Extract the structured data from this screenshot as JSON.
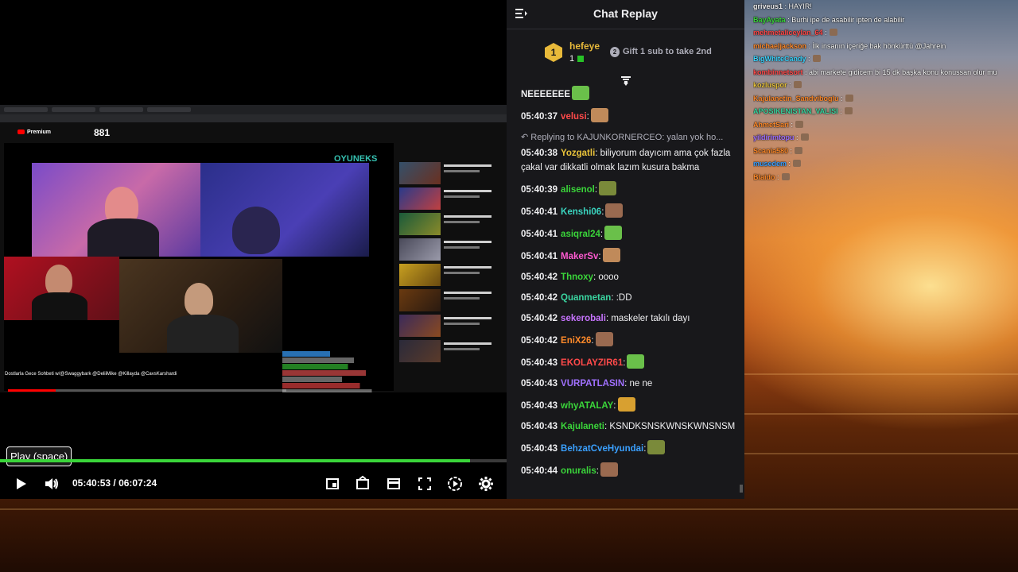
{
  "player": {
    "tooltip": "Play (space)",
    "current_time": "05:40:53",
    "separator": "/",
    "duration": "06:07:24",
    "progress_fraction": 0.928,
    "accent_color": "#3ad53a",
    "controls": {
      "play_icon": "play-icon",
      "volume_icon": "volume-icon",
      "miniplayer_icon": "miniplayer-icon",
      "theater_icon": "theater-icon",
      "cinema_icon": "cinema-icon",
      "fullscreen_icon": "fullscreen-icon",
      "speed_icon": "speed-icon",
      "settings_icon": "gear-icon"
    }
  },
  "video": {
    "viewer_count": "881",
    "site_label": "Premium",
    "overlay_logo": "OYUNEKS",
    "stream_title": "Dostlarla Gece Sohbeti w/@Swaggybark @DeliiMike @Killayda @CavsKarshardi"
  },
  "chat": {
    "title": "Chat Replay",
    "leaderboard": {
      "rank1": "1",
      "rank1_name": "hefeye",
      "rank1_count": "1",
      "rank2": "2",
      "rank2_text": "Gift 1 sub to take 2nd"
    },
    "messages": [
      {
        "ts": "",
        "user": "",
        "user_color": "#efeff1",
        "text": "NEEEEEEE"
      },
      {
        "ts": "05:40:37",
        "user": "velusi",
        "user_color": "#ff4a4a",
        "text": ":"
      },
      {
        "reply": "Replying to KAJUNKORNERCEO: yalan yok ho..."
      },
      {
        "ts": "05:40:38",
        "user": "Yozgatli",
        "user_color": "#e8c23a",
        "text": ": biliyorum dayıcım ama çok fazla çakal var dikkatli olmak lazım kusura bakma"
      },
      {
        "ts": "05:40:39",
        "user": "alisenol",
        "user_color": "#3ad53a",
        "text": ":"
      },
      {
        "ts": "05:40:41",
        "user": "Kenshi06",
        "user_color": "#3ad5c0",
        "text": ":"
      },
      {
        "ts": "05:40:41",
        "user": "asiqral24",
        "user_color": "#3ad53a",
        "text": ":"
      },
      {
        "ts": "05:40:41",
        "user": "MakerSv",
        "user_color": "#ff5ad1",
        "text": ":"
      },
      {
        "ts": "05:40:42",
        "user": "Thnoxy",
        "user_color": "#3ad53a",
        "text": ": oooo"
      },
      {
        "ts": "05:40:42",
        "user": "Quanmetan",
        "user_color": "#3ad5a0",
        "text": ": :DD"
      },
      {
        "ts": "05:40:42",
        "user": "sekerobali",
        "user_color": "#c774ff",
        "text": ": maskeler takılı dayı"
      },
      {
        "ts": "05:40:42",
        "user": "EniX26",
        "user_color": "#ff8a2a",
        "text": ":"
      },
      {
        "ts": "05:40:43",
        "user": "EKOLAYZIR61",
        "user_color": "#ff4a4a",
        "text": ":"
      },
      {
        "ts": "05:40:43",
        "user": "VURPATLASIN",
        "user_color": "#a070ff",
        "text": ": ne ne"
      },
      {
        "ts": "05:40:43",
        "user": "whyATALAY",
        "user_color": "#3ad53a",
        "text": ":"
      },
      {
        "ts": "05:40:43",
        "user": "Kajulaneti",
        "user_color": "#3ad53a",
        "text": ": KSNDKSNSKWNSKWNSNSM"
      },
      {
        "ts": "05:40:43",
        "user": "BehzatCveHyundai",
        "user_color": "#3aa0ff",
        "text": ":"
      },
      {
        "ts": "05:40:44",
        "user": "onuralis",
        "user_color": "#3ad53a",
        "text": ":"
      }
    ]
  },
  "overlay_chat": [
    {
      "user": "griveus1",
      "user_color": "#efeff1",
      "text": ": HAYIR!"
    },
    {
      "user": "BayAyata",
      "user_color": "#3ad53a",
      "text": ": Burhi ipe de asabilir ipten de alabilir"
    },
    {
      "user": "mehmetaliceylan_64",
      "user_color": "#ff4a4a",
      "text": ":"
    },
    {
      "user": "michaeljackson",
      "user_color": "#ff8a2a",
      "text": ": İlk insanın içeriğe bak hönkürttü @Jahrein"
    },
    {
      "user": "BigWhiteCandy",
      "user_color": "#3ad5ff",
      "text": ":"
    },
    {
      "user": "kombinnetsort",
      "user_color": "#ff4a4a",
      "text": ": abi markete gidicem bi 15 dk başka konu konussan olur mu"
    },
    {
      "user": "kozluspor",
      "user_color": "#e8c23a",
      "text": ":"
    },
    {
      "user": "Kajulanetin_Sandviboglu",
      "user_color": "#ff8a2a",
      "text": ":"
    },
    {
      "user": "APOSIKENISTAN_VALISI",
      "user_color": "#3ad5a0",
      "text": ":"
    },
    {
      "user": "AhmetSari",
      "user_color": "#ff8a2a",
      "text": ":"
    },
    {
      "user": "yildirimtopu",
      "user_color": "#a070ff",
      "text": ":"
    },
    {
      "user": "Scania580",
      "user_color": "#ff8a2a",
      "text": ":"
    },
    {
      "user": "musedem",
      "user_color": "#3aa0ff",
      "text": ":"
    },
    {
      "user": "Blaido",
      "user_color": "#ff8a2a",
      "text": ":"
    }
  ]
}
